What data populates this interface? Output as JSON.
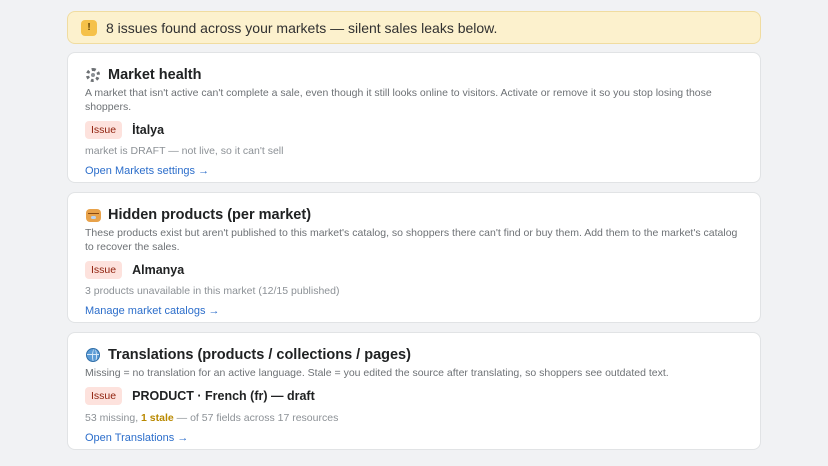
{
  "banner": {
    "icon": "warning-icon",
    "icon_glyph": "!",
    "text": "8 issues found across your markets — silent sales leaks below."
  },
  "cards": [
    {
      "icon": "gear-icon",
      "title": "Market health",
      "description": "A market that isn't active can't complete a sale, even though it still looks online to visitors. Activate or remove it so you stop losing those shoppers.",
      "badge": "Issue",
      "issue_name": "İtalya",
      "detail": "market is DRAFT — not live, so it can't sell",
      "link": "Open Markets settings →"
    },
    {
      "icon": "package-icon",
      "title": "Hidden products (per market)",
      "description": "These products exist but aren't published to this market's catalog, so shoppers there can't find or buy them. Add them to the market's catalog to recover the sales.",
      "badge": "Issue",
      "issue_name": "Almanya",
      "detail": "3 products unavailable in this market (12/15 published)",
      "link": "Manage market catalogs →"
    },
    {
      "icon": "globe-icon",
      "title": "Translations (products / collections / pages)",
      "description": "Missing = no translation for an active language. Stale = you edited the source after translating, so shoppers see outdated text.",
      "badge": "Issue",
      "issue_name": "PRODUCT · French (fr) — draft",
      "detail_prefix": "53 missing,",
      "detail_stale": "1 stale",
      "detail_suffix": "— of 57 fields across 17 resources",
      "link": "Open Translations →"
    }
  ],
  "colors": {
    "banner_bg": "#fcf1cd",
    "badge_bg": "#fde2dd",
    "badge_text": "#8e1f0b",
    "link": "#2c6ecb",
    "stale": "#b98900"
  }
}
